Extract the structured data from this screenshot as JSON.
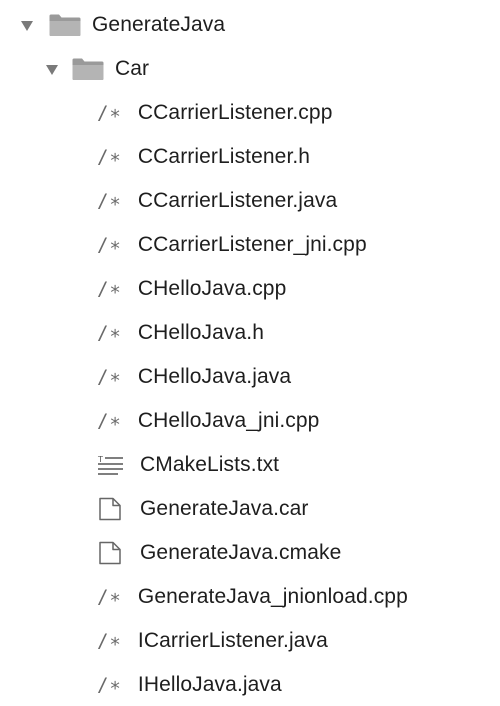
{
  "tree": {
    "root": {
      "label": "GenerateJava",
      "expanded": true,
      "icon": "folder-icon"
    },
    "child_folder": {
      "label": "Car",
      "expanded": true,
      "icon": "folder-icon"
    },
    "code_icon_glyph": "/∗",
    "files": [
      {
        "label": "CCarrierListener.cpp",
        "icon": "source-code-icon"
      },
      {
        "label": "CCarrierListener.h",
        "icon": "source-code-icon"
      },
      {
        "label": "CCarrierListener.java",
        "icon": "source-code-icon"
      },
      {
        "label": "CCarrierListener_jni.cpp",
        "icon": "source-code-icon"
      },
      {
        "label": "CHelloJava.cpp",
        "icon": "source-code-icon"
      },
      {
        "label": "CHelloJava.h",
        "icon": "source-code-icon"
      },
      {
        "label": "CHelloJava.java",
        "icon": "source-code-icon"
      },
      {
        "label": "CHelloJava_jni.cpp",
        "icon": "source-code-icon"
      },
      {
        "label": "CMakeLists.txt",
        "icon": "text-file-icon"
      },
      {
        "label": "GenerateJava.car",
        "icon": "blank-file-icon"
      },
      {
        "label": "GenerateJava.cmake",
        "icon": "blank-file-icon"
      },
      {
        "label": "GenerateJava_jnionload.cpp",
        "icon": "source-code-icon"
      },
      {
        "label": "ICarrierListener.java",
        "icon": "source-code-icon"
      },
      {
        "label": "IHelloJava.java",
        "icon": "source-code-icon"
      }
    ]
  }
}
